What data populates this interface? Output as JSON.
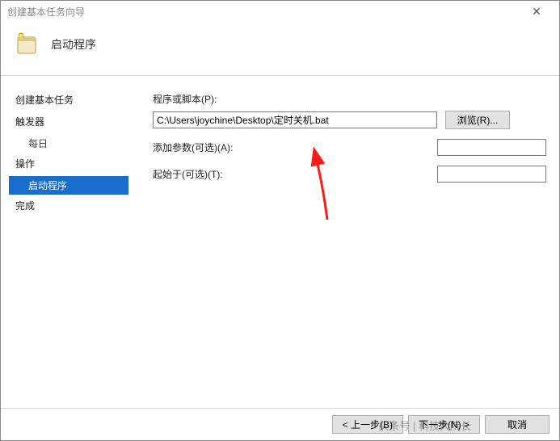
{
  "window": {
    "title": "创建基本任务向导"
  },
  "header": {
    "title": "启动程序"
  },
  "sidebar": {
    "step_create": "创建基本任务",
    "step_trigger": "触发器",
    "step_trigger_daily": "每日",
    "step_action": "操作",
    "step_action_start": "启动程序",
    "step_finish": "完成"
  },
  "form": {
    "program_label": "程序或脚本(P):",
    "program_value": "C:\\Users\\joychine\\Desktop\\定时关机.bat",
    "browse_label": "浏览(R)...",
    "args_label": "添加参数(可选)(A):",
    "args_value": "",
    "startin_label": "起始于(可选)(T):",
    "startin_value": ""
  },
  "footer": {
    "back": "< 上一步(B)",
    "next": "下一步(N) >",
    "cancel": "取消"
  },
  "watermark": "头条号 | 科技大院长"
}
